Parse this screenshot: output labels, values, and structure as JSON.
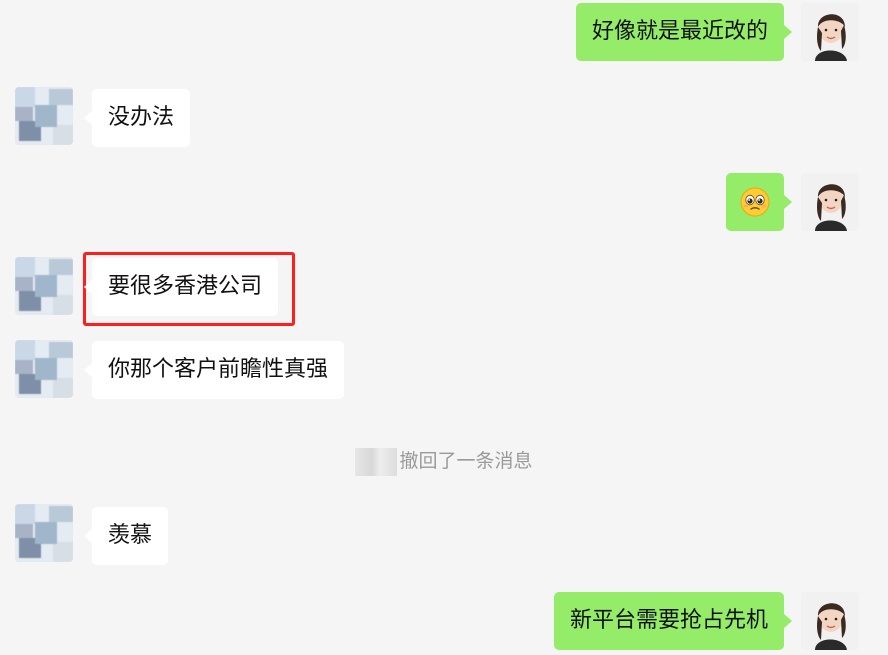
{
  "messages": [
    {
      "side": "right",
      "text": "好像就是最近改的"
    },
    {
      "side": "left",
      "text": "没办法"
    },
    {
      "side": "right",
      "type": "emoji",
      "emoji": "pleading-face"
    },
    {
      "side": "left",
      "text": "要很多香港公司",
      "highlighted": true
    },
    {
      "side": "left",
      "text": "你那个客户前瞻性真强"
    },
    {
      "type": "system",
      "text": "撤回了一条消息"
    },
    {
      "side": "left",
      "text": "羡慕"
    },
    {
      "side": "right",
      "text": "新平台需要抢占先机"
    }
  ],
  "colors": {
    "background": "#f5f5f5",
    "own_bubble": "#95ec69",
    "other_bubble": "#ffffff",
    "highlight_border": "#ff1e1e",
    "system_text": "#9a9a9a"
  }
}
